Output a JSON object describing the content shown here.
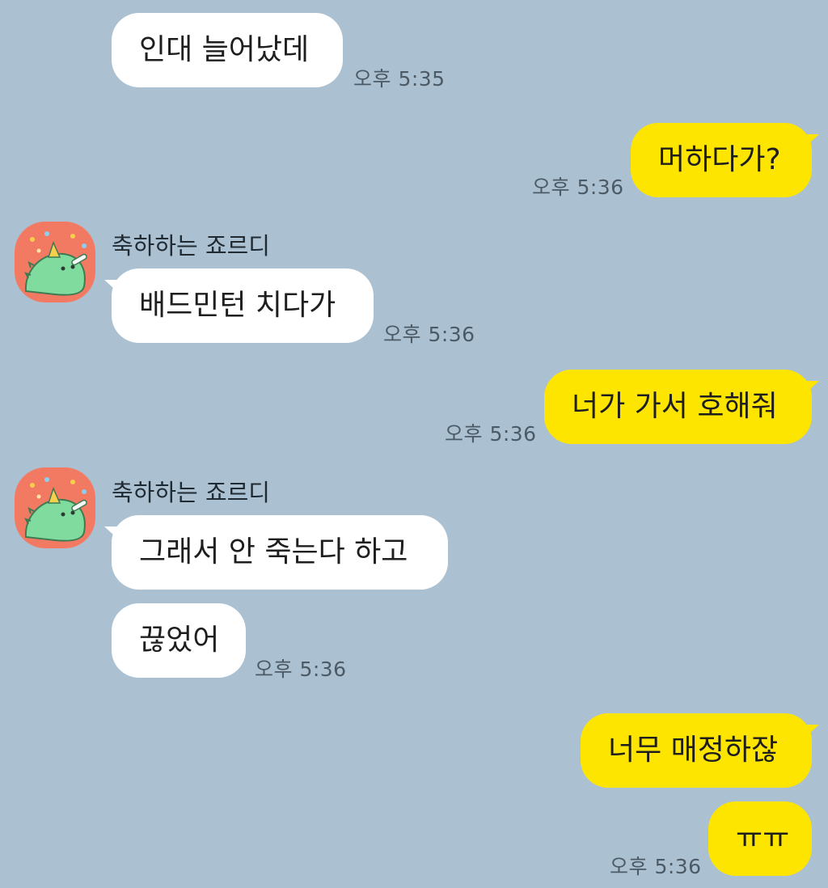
{
  "chat": {
    "messages": [
      {
        "side": "in",
        "text": "인대 늘어났데",
        "time": "오후 5:35"
      },
      {
        "side": "out",
        "text": "머하다가?",
        "time": "오후 5:36"
      },
      {
        "side": "in",
        "sender": "축하하는 죠르디",
        "text": "배드민턴 치다가",
        "time": "오후 5:36"
      },
      {
        "side": "out",
        "text": "너가 가서 호해줘",
        "time": "오후 5:36"
      },
      {
        "side": "in",
        "sender": "축하하는 죠르디",
        "text": "그래서 안 죽는다 하고"
      },
      {
        "side": "in",
        "text": "끊었어",
        "time": "오후 5:36"
      },
      {
        "side": "out",
        "text": "너무 매정하잖"
      },
      {
        "side": "out",
        "text": "ㅠㅠ",
        "time": "오후 5:36"
      }
    ]
  },
  "colors": {
    "background": "#abc1d1",
    "incoming_bubble": "#ffffff",
    "outgoing_bubble": "#fee500",
    "avatar_bg": "#f27a62",
    "avatar_character": "#7fdc9e"
  },
  "icons": {
    "avatar": "jordy-party-avatar-icon"
  }
}
